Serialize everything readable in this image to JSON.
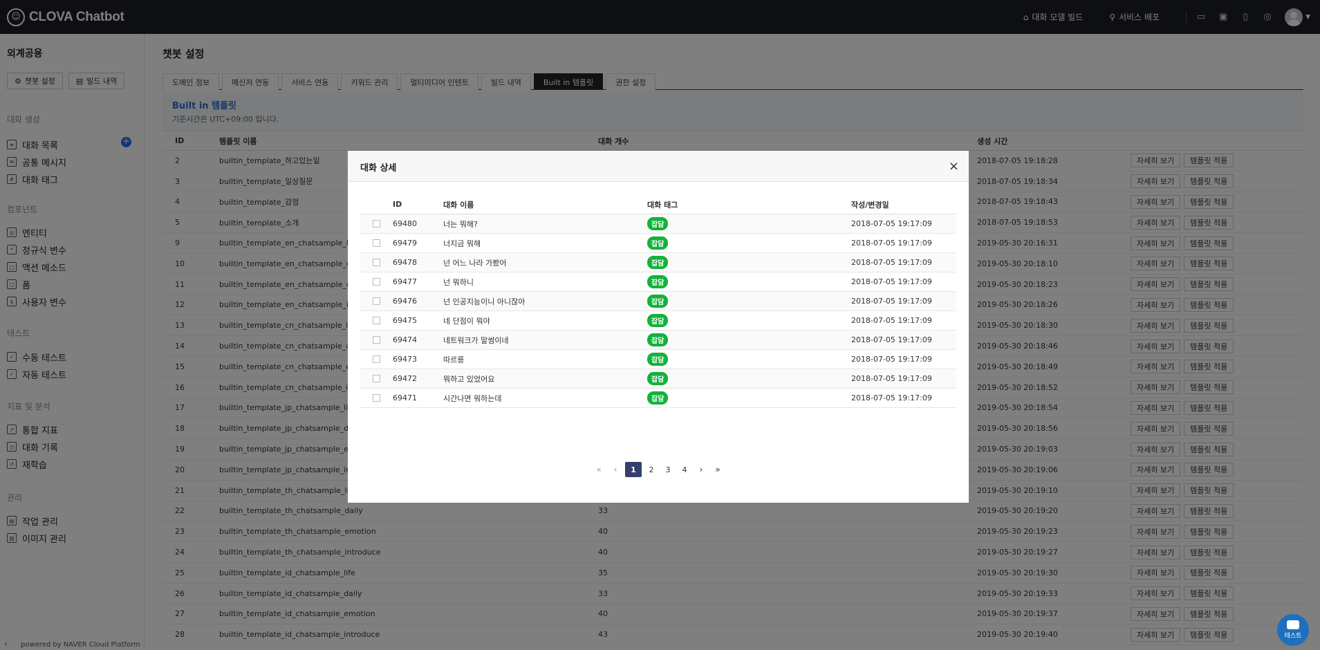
{
  "app": {
    "brand": "CLOVA Chatbot",
    "topnav": {
      "build": "대화 모델 빌드",
      "deploy": "서비스 배포"
    }
  },
  "sidebar": {
    "project": "외계공용",
    "buttons": [
      "챗봇 설정",
      "빌드 내역"
    ],
    "sections": [
      {
        "title": "대화 생성",
        "items": [
          "대화 목록",
          "공통 메시지",
          "대화 태그"
        ]
      },
      {
        "title": "컴포넌트",
        "items": [
          "엔티티",
          "정규식 변수",
          "액션 메소드",
          "폼",
          "사용자 변수"
        ]
      },
      {
        "title": "테스트",
        "items": [
          "수동 테스트",
          "자동 테스트"
        ]
      },
      {
        "title": "지표 및 분석",
        "items": [
          "통합 지표",
          "대화 기록",
          "재학습"
        ]
      },
      {
        "title": "관리",
        "items": [
          "작업 관리",
          "이미지 관리"
        ]
      }
    ],
    "powered": "powered by NAVER Cloud Platform"
  },
  "main": {
    "title": "챗봇 설정",
    "tabs": [
      "도메인 정보",
      "메신저 연동",
      "서비스 연동",
      "키워드 관리",
      "멀티미디어 인텐트",
      "빌드 내역",
      "Built in 템플릿",
      "권한 설정"
    ],
    "panel_title": "Built in 템플릿",
    "panel_sub": "기준시간은 UTC+09:00 입니다.",
    "columns": [
      "ID",
      "템플릿 이름",
      "대화 개수",
      "생성 시간"
    ],
    "actions": [
      "자세히 보기",
      "템플릿 적용"
    ],
    "rows": [
      {
        "id": "2",
        "name": "builtin_template_하고있는일",
        "count": "",
        "time": "2018-07-05 19:18:28"
      },
      {
        "id": "3",
        "name": "builtin_template_일상질문",
        "count": "",
        "time": "2018-07-05 19:18:34"
      },
      {
        "id": "4",
        "name": "builtin_template_감정",
        "count": "",
        "time": "2018-07-05 19:18:43"
      },
      {
        "id": "5",
        "name": "builtin_template_소개",
        "count": "",
        "time": "2018-07-05 19:18:53"
      },
      {
        "id": "9",
        "name": "builtin_template_en_chatsample_lif",
        "count": "",
        "time": "2019-05-30 20:16:31"
      },
      {
        "id": "10",
        "name": "builtin_template_en_chatsample_da",
        "count": "",
        "time": "2019-05-30 20:18:10"
      },
      {
        "id": "11",
        "name": "builtin_template_en_chatsample_er",
        "count": "",
        "time": "2019-05-30 20:18:23"
      },
      {
        "id": "12",
        "name": "builtin_template_en_chatsample_in",
        "count": "",
        "time": "2019-05-30 20:18:26"
      },
      {
        "id": "13",
        "name": "builtin_template_cn_chatsample_lif",
        "count": "",
        "time": "2019-05-30 20:18:30"
      },
      {
        "id": "14",
        "name": "builtin_template_cn_chatsample_da",
        "count": "",
        "time": "2019-05-30 20:18:46"
      },
      {
        "id": "15",
        "name": "builtin_template_cn_chatsample_er",
        "count": "",
        "time": "2019-05-30 20:18:49"
      },
      {
        "id": "16",
        "name": "builtin_template_cn_chatsample_in",
        "count": "",
        "time": "2019-05-30 20:18:52"
      },
      {
        "id": "17",
        "name": "builtin_template_jp_chatsample_life",
        "count": "",
        "time": "2019-05-30 20:18:54"
      },
      {
        "id": "18",
        "name": "builtin_template_jp_chatsample_da",
        "count": "",
        "time": "2019-05-30 20:18:56"
      },
      {
        "id": "19",
        "name": "builtin_template_jp_chatsample_em",
        "count": "",
        "time": "2019-05-30 20:19:03"
      },
      {
        "id": "20",
        "name": "builtin_template_jp_chatsample_int",
        "count": "",
        "time": "2019-05-30 20:19:06"
      },
      {
        "id": "21",
        "name": "builtin_template_th_chatsample_life",
        "count": "",
        "time": "2019-05-30 20:19:10"
      },
      {
        "id": "22",
        "name": "builtin_template_th_chatsample_daily",
        "count": "33",
        "time": "2019-05-30 20:19:20"
      },
      {
        "id": "23",
        "name": "builtin_template_th_chatsample_emotion",
        "count": "40",
        "time": "2019-05-30 20:19:23"
      },
      {
        "id": "24",
        "name": "builtin_template_th_chatsample_introduce",
        "count": "40",
        "time": "2019-05-30 20:19:27"
      },
      {
        "id": "25",
        "name": "builtin_template_id_chatsample_life",
        "count": "35",
        "time": "2019-05-30 20:19:30"
      },
      {
        "id": "26",
        "name": "builtin_template_id_chatsample_daily",
        "count": "33",
        "time": "2019-05-30 20:19:33"
      },
      {
        "id": "27",
        "name": "builtin_template_id_chatsample_emotion",
        "count": "40",
        "time": "2019-05-30 20:19:37"
      },
      {
        "id": "28",
        "name": "builtin_template_id_chatsample_introduce",
        "count": "43",
        "time": "2019-05-30 20:19:40"
      }
    ]
  },
  "modal": {
    "title": "대화 상세",
    "columns": [
      "ID",
      "대화 이름",
      "대화 태그",
      "작성/변경일"
    ],
    "rows": [
      {
        "id": "69480",
        "name": "너는 뭐해?",
        "tag": "잡담",
        "date": "2018-07-05 19:17:09"
      },
      {
        "id": "69479",
        "name": "너지금 뭐해",
        "tag": "잡담",
        "date": "2018-07-05 19:17:09"
      },
      {
        "id": "69478",
        "name": "넌 어느 나라 가봤어",
        "tag": "잡담",
        "date": "2018-07-05 19:17:09"
      },
      {
        "id": "69477",
        "name": "넌 뭐하니",
        "tag": "잡담",
        "date": "2018-07-05 19:17:09"
      },
      {
        "id": "69476",
        "name": "넌 인공지능이니 아니잖아",
        "tag": "잡담",
        "date": "2018-07-05 19:17:09"
      },
      {
        "id": "69475",
        "name": "네 단점이 뭐야",
        "tag": "잡담",
        "date": "2018-07-05 19:17:09"
      },
      {
        "id": "69474",
        "name": "네트워크가 말썽이네",
        "tag": "잡담",
        "date": "2018-07-05 19:17:09"
      },
      {
        "id": "69473",
        "name": "따르릉",
        "tag": "잡담",
        "date": "2018-07-05 19:17:09"
      },
      {
        "id": "69472",
        "name": "뭐하고 있었어요",
        "tag": "잡담",
        "date": "2018-07-05 19:17:09"
      },
      {
        "id": "69471",
        "name": "시간나면 뭐하는데",
        "tag": "잡담",
        "date": "2018-07-05 19:17:09"
      }
    ],
    "pages": [
      "1",
      "2",
      "3",
      "4"
    ],
    "current_page": "1"
  },
  "fab": {
    "label": "테스트"
  },
  "colors": {
    "topbar": "#1c1f24",
    "tag_green": "#13b23b",
    "accent_blue": "#2a6fd1",
    "pager_active": "#34406b"
  }
}
